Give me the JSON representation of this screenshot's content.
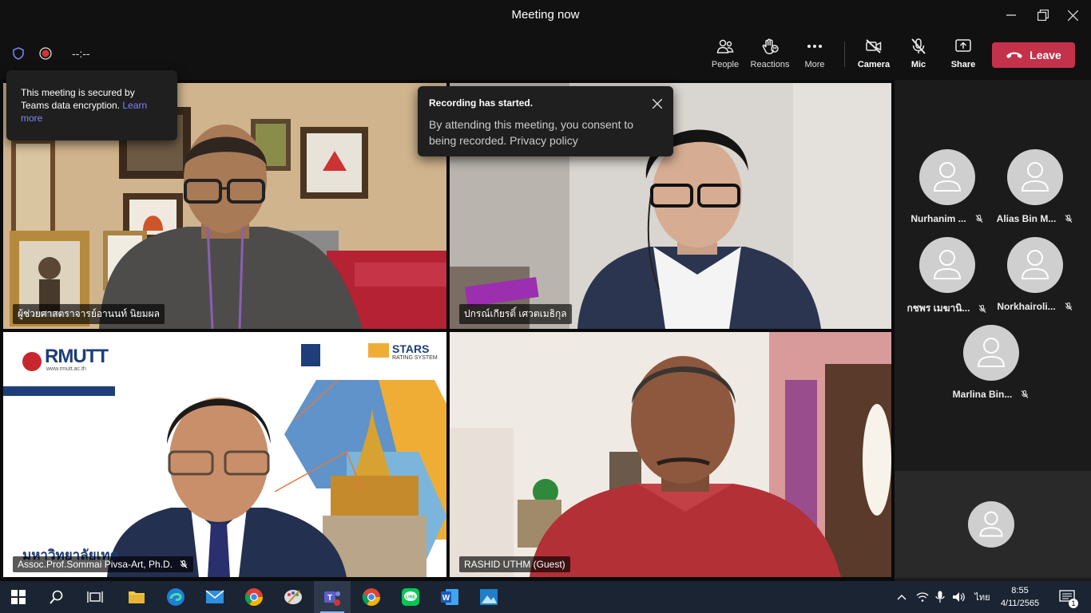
{
  "window": {
    "title": "Meeting now"
  },
  "toolbar": {
    "timer": "--:--",
    "people": "People",
    "reactions": "Reactions",
    "more": "More",
    "camera": "Camera",
    "mic": "Mic",
    "share": "Share",
    "leave": "Leave"
  },
  "security_popup": {
    "text": "This meeting is secured by Teams data encryption.",
    "link": "Learn more"
  },
  "recording_popup": {
    "title": "Recording has started.",
    "body": "By attending this meeting, you consent to being recorded. Privacy policy"
  },
  "tiles": [
    {
      "name": "ผู้ช่วยศาสตราจารย์อานนท์ นิยมผล"
    },
    {
      "name": "ปกรณ์เกียรติ์ เศวตเมธิกุล"
    },
    {
      "name": "Assoc.Prof.Sommai Pivsa-Art, Ph.D.",
      "muted": true
    },
    {
      "name": "RASHID UTHM (Guest)"
    }
  ],
  "slide": {
    "logo": "RMUTT",
    "url": "www.rmutt.ac.th",
    "stars_title": "STARS",
    "stars_sub": "RATING SYSTEM",
    "thai_title": "มหาวิทยาลัยเทค"
  },
  "participants": [
    {
      "name": "Nurhanim ...",
      "muted": true
    },
    {
      "name": "Alias Bin M...",
      "muted": true
    },
    {
      "name": "กชพร เมฆานิ...",
      "muted": true
    },
    {
      "name": "Norkhairoli...",
      "muted": true
    },
    {
      "name": "Marlina Bin...",
      "muted": true
    }
  ],
  "tray": {
    "lang": "ไทย",
    "time": "8:55",
    "date": "4/11/2565",
    "notifications": "1"
  },
  "colors": {
    "leave": "#c4314b",
    "link": "#7f85f5",
    "taskbar": "#1a2433"
  }
}
